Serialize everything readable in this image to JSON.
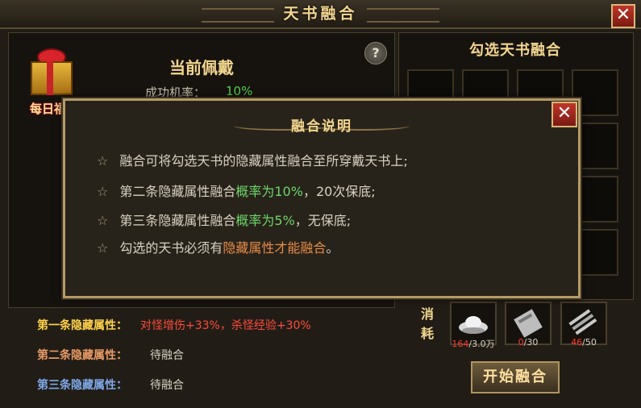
{
  "window": {
    "title": "天书融合",
    "close_icon": "close-icon"
  },
  "gift": {
    "label": "每日福利",
    "icon": "gift-box-icon"
  },
  "wear": {
    "title": "当前佩戴",
    "rate_label": "成功机率：",
    "rate_value": "10%"
  },
  "help": {
    "glyph": "?"
  },
  "select_panel": {
    "title": "勾选天书融合"
  },
  "dialog": {
    "title": "融合说明",
    "rules": [
      {
        "segments": [
          {
            "text": "融合可将勾选天书的隐藏属性融合至所穿戴天书上;",
            "color": "normal"
          }
        ]
      },
      {
        "segments": [
          {
            "text": "第二条隐藏属性融合",
            "color": "normal"
          },
          {
            "text": "概率为10%",
            "color": "green"
          },
          {
            "text": "，20次保底;",
            "color": "normal"
          }
        ]
      },
      {
        "segments": [
          {
            "text": "第三条隐藏属性融合",
            "color": "normal"
          },
          {
            "text": "概率为5%",
            "color": "green"
          },
          {
            "text": "，无保底;",
            "color": "normal"
          }
        ]
      },
      {
        "segments": [
          {
            "text": "勾选的天书必须有",
            "color": "normal"
          },
          {
            "text": "隐藏属性才能融合",
            "color": "orange"
          },
          {
            "text": "。",
            "color": "normal"
          }
        ]
      }
    ]
  },
  "properties": [
    {
      "label": "第一条隐藏属性：",
      "value": "对怪增伤+33%，杀怪经验+30%",
      "label_color": "#ffd24a",
      "value_color": "#ff4b3c"
    },
    {
      "label": "第二条隐藏属性：",
      "value": "待融合",
      "label_color": "#e89a66",
      "value_color": "#d7d2c4"
    },
    {
      "label": "第三条隐藏属性：",
      "value": "待融合",
      "label_color": "#7fa8e8",
      "value_color": "#d7d2c4"
    }
  ],
  "consume": {
    "label": "消耗",
    "items": [
      {
        "icon": "silver-ingot-icon",
        "have": "164",
        "need": "/3.0万"
      },
      {
        "icon": "silver-scroll-icon",
        "have": "0",
        "need": "/30"
      },
      {
        "icon": "scroll-bundle-icon",
        "have": "46",
        "need": "/50"
      }
    ]
  },
  "start_button": {
    "label": "开始融合"
  }
}
